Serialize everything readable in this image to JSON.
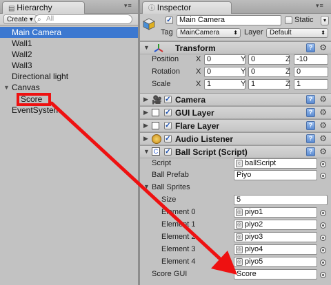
{
  "hierarchy": {
    "tab_label": "Hierarchy",
    "create_label": "Create",
    "search_placeholder": "All",
    "items": [
      {
        "label": "Main Camera"
      },
      {
        "label": "Wall1"
      },
      {
        "label": "Wall2"
      },
      {
        "label": "Wall3"
      },
      {
        "label": "Directional light"
      },
      {
        "label": "Canvas"
      },
      {
        "label": "Score"
      },
      {
        "label": "EventSystem"
      }
    ]
  },
  "inspector": {
    "tab_label": "Inspector",
    "object_name": "Main Camera",
    "static_label": "Static",
    "tag_label": "Tag",
    "tag_value": "MainCamera",
    "layer_label": "Layer",
    "layer_value": "Default",
    "transform": {
      "title": "Transform",
      "position_label": "Position",
      "rotation_label": "Rotation",
      "scale_label": "Scale",
      "x": "X",
      "y": "Y",
      "z": "Z",
      "position": [
        "0",
        "0",
        "-10"
      ],
      "rotation": [
        "0",
        "0",
        "0"
      ],
      "scale": [
        "1",
        "1",
        "1"
      ]
    },
    "components": {
      "camera": "Camera",
      "gui_layer": "GUI Layer",
      "flare_layer": "Flare Layer",
      "audio_listener": "Audio Listener",
      "ball_script": "Ball Script (Script)"
    },
    "ball_script": {
      "script_label": "Script",
      "script_value": "ballScript",
      "prefab_label": "Ball Prefab",
      "prefab_value": "Piyo",
      "sprites_label": "Ball Sprites",
      "size_label": "Size",
      "size_value": "5",
      "elements": [
        {
          "label": "Element 0",
          "value": "piyo1"
        },
        {
          "label": "Element 1",
          "value": "piyo2"
        },
        {
          "label": "Element 2",
          "value": "piyo3"
        },
        {
          "label": "Element 3",
          "value": "piyo4"
        },
        {
          "label": "Element 4",
          "value": "piyo5"
        }
      ],
      "score_gui_label": "Score GUI",
      "score_gui_value": "Score"
    }
  },
  "colors": {
    "selection": "#3c78d0",
    "annotation_red": "#ee1111",
    "panel_bg": "#c2c2c2"
  }
}
